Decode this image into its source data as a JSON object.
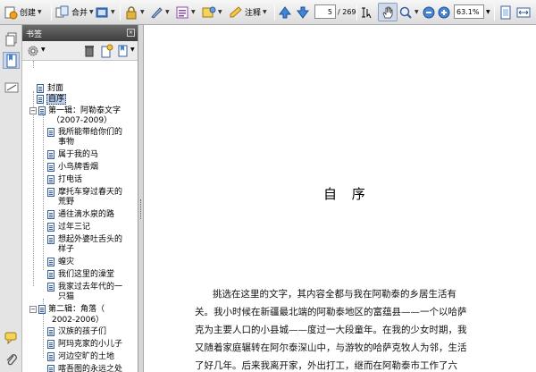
{
  "toolbar": {
    "create_label": "创建",
    "combine_label": "合并",
    "annotate_label": "注释",
    "page_current": "5",
    "page_total": "/ 269",
    "zoom_value": "63.1%"
  },
  "panel": {
    "title": "书签",
    "close_glyph": "×"
  },
  "bookmarks": [
    {
      "label": "封面"
    },
    {
      "label": "自序"
    },
    {
      "label": "第一辑：阿勒泰文字"
    },
    {
      "label": "（2007-2009）"
    },
    {
      "label": "我所能带给你们的"
    },
    {
      "label": "事物"
    },
    {
      "label": "属于我的马"
    },
    {
      "label": "小鸟牌香烟"
    },
    {
      "label": "打电话"
    },
    {
      "label": "摩托车穿过春天的"
    },
    {
      "label": "荒野"
    },
    {
      "label": "通往滴水泉的路"
    },
    {
      "label": "过年三记"
    },
    {
      "label": "想起外婆吐舌头的"
    },
    {
      "label": "样子"
    },
    {
      "label": "蝗灾"
    },
    {
      "label": "我们这里的澡堂"
    },
    {
      "label": "我家过去年代的一"
    },
    {
      "label": "只猫"
    },
    {
      "label": "第二辑：角落（"
    },
    {
      "label": "2002-2006）"
    },
    {
      "label": "汉族的孩子们"
    },
    {
      "label": "阿玛克家的小儿子"
    },
    {
      "label": "河边空旷的土地"
    },
    {
      "label": "喀吾图的永远之处"
    }
  ],
  "document": {
    "title": "自 序",
    "lines": [
      "挑选在这里的文字，其内容全都与我在阿勒泰的乡居生活有",
      "关。我小时候在新疆最北端的阿勒泰地区的富蕴县——一个以哈萨",
      "克为主要人口的小县城——度过一大段童年。在我的少女时期，我",
      "又随着家庭辗转在阿尔泰深山中，与游牧的哈萨克牧人为邻，生活",
      "了好几年。后来我离开家，外出打工，继而在阿勒泰市工作了六"
    ]
  },
  "colors": {
    "panel_header": "#4a4a4a",
    "selection": "#b9cfee",
    "toolbar_bg": "#e6e6e6"
  }
}
